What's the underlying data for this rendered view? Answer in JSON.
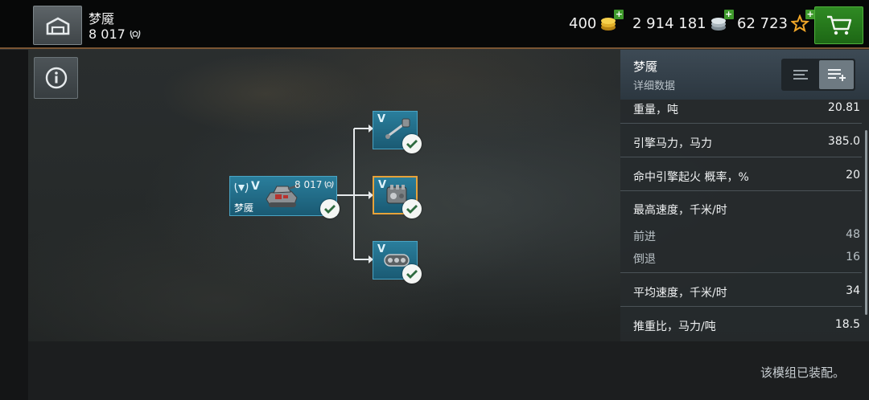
{
  "topbar": {
    "tank_name": "梦魇",
    "tank_rating": "8 017",
    "gold": "400",
    "credits": "2 914 181",
    "free_xp": "62 723"
  },
  "tree": {
    "tank_node": {
      "tier": "V",
      "rating": "8 017",
      "name": "梦魇"
    },
    "modules": [
      {
        "tier": "V",
        "icon": "gun-icon",
        "selected": false
      },
      {
        "tier": "V",
        "icon": "engine-icon",
        "selected": true
      },
      {
        "tier": "V",
        "icon": "tracks-icon",
        "selected": false
      }
    ]
  },
  "panel": {
    "title": "梦魇",
    "subtitle": "详细数据",
    "stats": [
      {
        "label": "重量，吨",
        "value": "20.81"
      },
      {
        "label": "引擎马力，马力",
        "value": "385.0"
      },
      {
        "label": "命中引擎起火 概率，%",
        "value": "20"
      },
      {
        "label": "最高速度，千米/时",
        "value": ""
      },
      {
        "label": "前进",
        "value": "48"
      },
      {
        "label": "倒退",
        "value": "16"
      },
      {
        "label": "平均速度，千米/时",
        "value": "34"
      },
      {
        "label": "推重比，马力/吨",
        "value": "18.5"
      }
    ]
  },
  "status": {
    "text": "该模组已装配。"
  },
  "colors": {
    "accent_orange": "#e6a23a",
    "node_blue": "#1f6a86",
    "shop_green": "#2a7f1f"
  }
}
